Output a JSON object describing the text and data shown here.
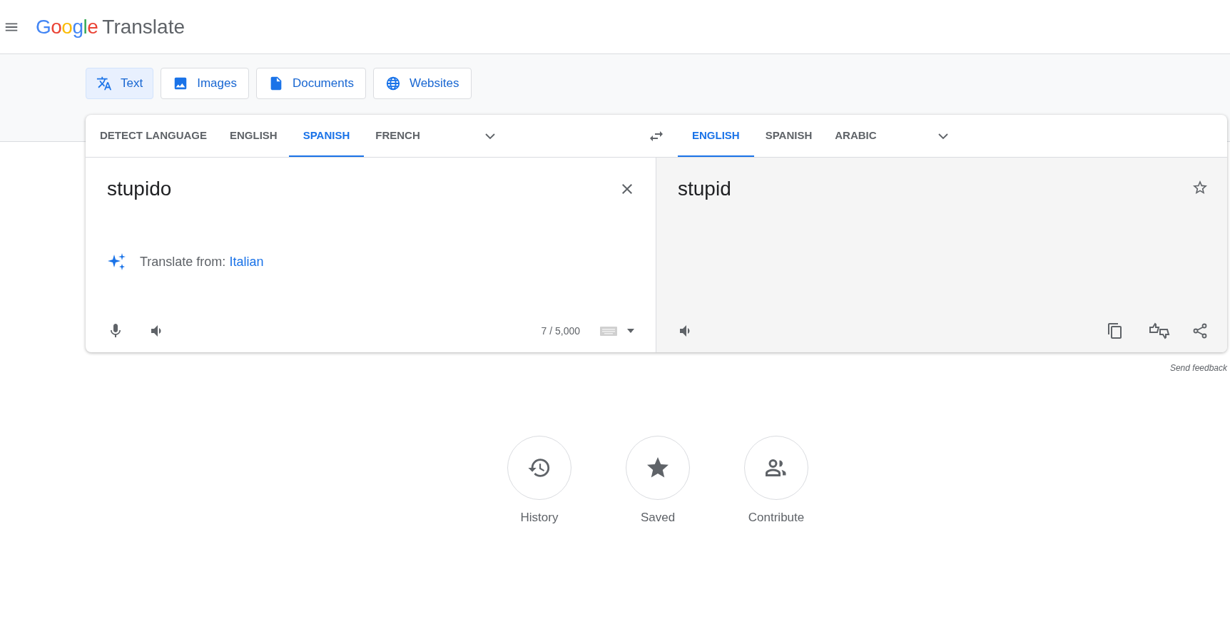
{
  "header": {
    "logo": "Google",
    "product": "Translate"
  },
  "modes": [
    {
      "label": "Text",
      "kind": "text",
      "selected": true
    },
    {
      "label": "Images",
      "kind": "images",
      "selected": false
    },
    {
      "label": "Documents",
      "kind": "documents",
      "selected": false
    },
    {
      "label": "Websites",
      "kind": "websites",
      "selected": false
    }
  ],
  "source_languages": [
    {
      "label": "DETECT LANGUAGE",
      "selected": false
    },
    {
      "label": "ENGLISH",
      "selected": false
    },
    {
      "label": "SPANISH",
      "selected": true
    },
    {
      "label": "FRENCH",
      "selected": false
    }
  ],
  "target_languages": [
    {
      "label": "ENGLISH",
      "selected": true
    },
    {
      "label": "SPANISH",
      "selected": false
    },
    {
      "label": "ARABIC",
      "selected": false
    }
  ],
  "source": {
    "text": "stupido",
    "suggestion_label": "Translate from:",
    "suggestion_language": "Italian",
    "char_count": "7 / 5,000"
  },
  "translation": {
    "text": "stupid"
  },
  "send_feedback": "Send feedback",
  "shortcuts": [
    {
      "label": "History",
      "kind": "history"
    },
    {
      "label": "Saved",
      "kind": "saved"
    },
    {
      "label": "Contribute",
      "kind": "contribute"
    }
  ]
}
